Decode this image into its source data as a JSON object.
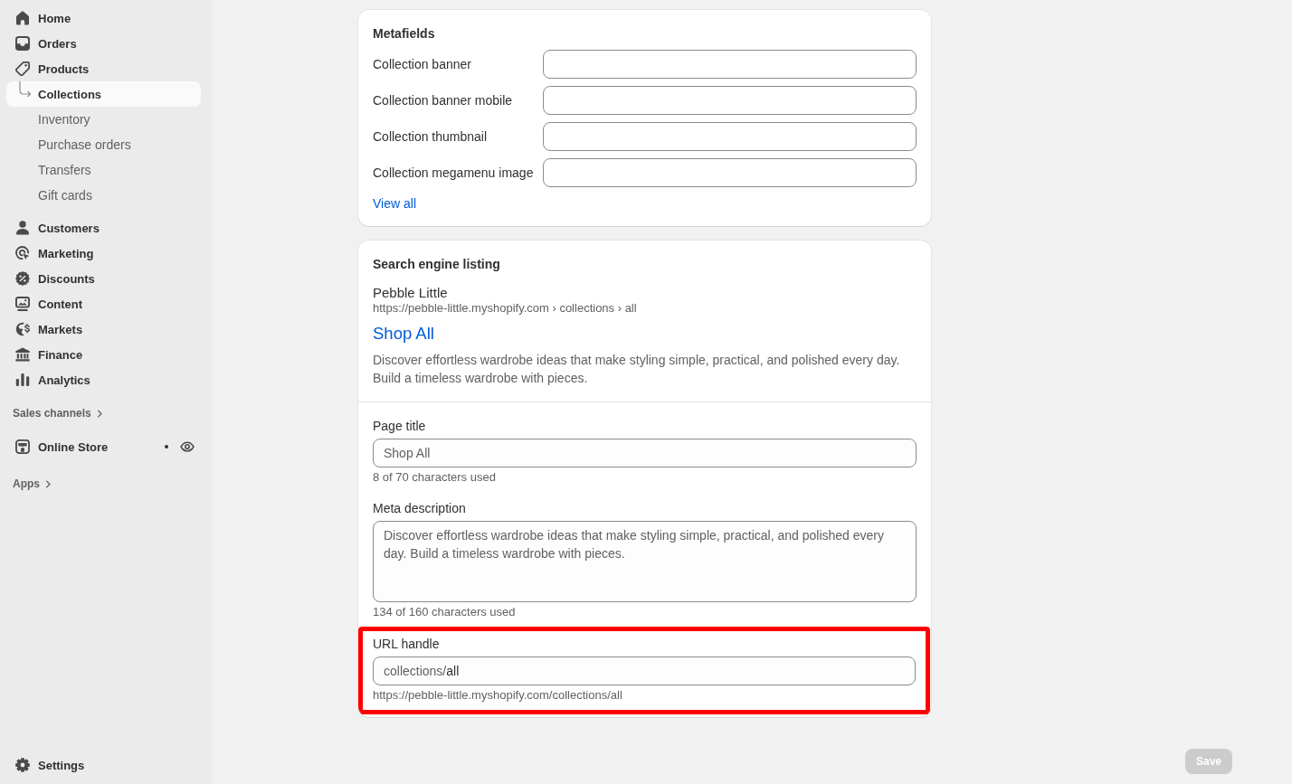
{
  "sidebar": {
    "items": [
      {
        "label": "Home",
        "selected": false
      },
      {
        "label": "Orders",
        "selected": false
      },
      {
        "label": "Products",
        "selected": false,
        "children": [
          {
            "label": "Collections",
            "selected": true
          },
          {
            "label": "Inventory",
            "selected": false
          },
          {
            "label": "Purchase orders",
            "selected": false
          },
          {
            "label": "Transfers",
            "selected": false
          },
          {
            "label": "Gift cards",
            "selected": false
          }
        ]
      },
      {
        "label": "Customers",
        "selected": false
      },
      {
        "label": "Marketing",
        "selected": false
      },
      {
        "label": "Discounts",
        "selected": false
      },
      {
        "label": "Content",
        "selected": false
      },
      {
        "label": "Markets",
        "selected": false
      },
      {
        "label": "Finance",
        "selected": false
      },
      {
        "label": "Analytics",
        "selected": false
      }
    ],
    "sales_channels": {
      "label": "Sales channels",
      "items": [
        {
          "label": "Online Store",
          "selected": false
        }
      ]
    },
    "apps": {
      "label": "Apps"
    },
    "settings": {
      "label": "Settings",
      "selected": false
    }
  },
  "metafields": {
    "title": "Metafields",
    "fields": [
      {
        "label": "Collection banner"
      },
      {
        "label": "Collection banner mobile"
      },
      {
        "label": "Collection thumbnail"
      },
      {
        "label": "Collection megamenu image"
      }
    ],
    "link": "View all"
  },
  "search_engine_listing": {
    "title": "Search engine listing",
    "preview": {
      "site_name": "Pebble Little",
      "url": "https://pebble-little.myshopify.com › collections › all",
      "title": "Shop All",
      "description": "Discover effortless wardrobe ideas that make styling simple, practical, and polished every day. Build a timeless wardrobe with pieces."
    },
    "page_title": {
      "label": "Page title",
      "value": "Shop All",
      "hint": "8 of 70 characters used"
    },
    "meta_description": {
      "label": "Meta description",
      "value": "Discover effortless wardrobe ideas that make styling simple, practical, and polished every day. Build a timeless wardrobe with pieces.",
      "hint": "134 of 160 characters used"
    },
    "url_handle": {
      "label": "URL handle",
      "prefix": "collections/",
      "value": "all",
      "hint": "https://pebble-little.myshopify.com/collections/all",
      "highlighted": true
    }
  },
  "save_button": {
    "label": "Save",
    "disabled": true
  }
}
